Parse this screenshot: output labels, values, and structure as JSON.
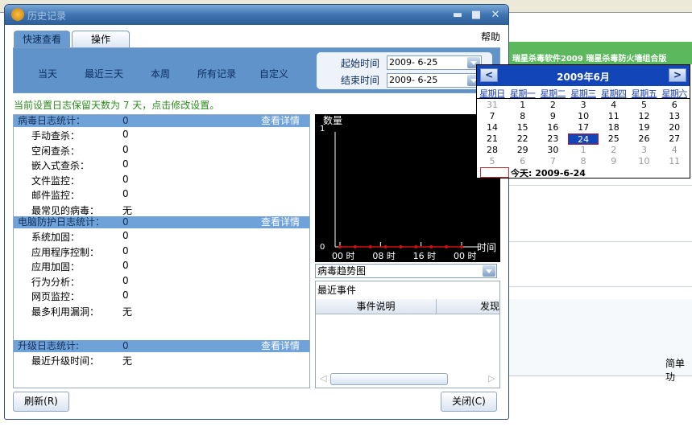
{
  "background": {
    "banner": "瑞星杀毒软件2009  瑞星杀毒防火墙组合版",
    "bottom_text": "简单功"
  },
  "window": {
    "title": "历史记录",
    "minimize": "▬",
    "maximize": "■",
    "close": "✕"
  },
  "tabs": [
    {
      "label": "快速查看"
    },
    {
      "label": "操作"
    }
  ],
  "help": "帮助",
  "quick_links": [
    "当天",
    "最近三天",
    "本周",
    "所有记录",
    "自定义"
  ],
  "dates": {
    "start_label": "起始时间",
    "start_value": "2009- 6-25",
    "end_label": "结束时间",
    "end_value": "2009- 6-25"
  },
  "notice": "当前设置日志保留天数为 7 天，点击修改设置。",
  "sections": [
    {
      "title": "病毒日志统计：",
      "value": "0",
      "detail": "查看详情",
      "rows": [
        {
          "label": "手动查杀：",
          "value": "0"
        },
        {
          "label": "空闲查杀：",
          "value": "0"
        },
        {
          "label": "嵌入式查杀：",
          "value": "0"
        },
        {
          "label": "文件监控：",
          "value": "0"
        },
        {
          "label": "邮件监控：",
          "value": "0"
        },
        {
          "label": "最常见的病毒：",
          "value": "无"
        }
      ]
    },
    {
      "title": "电脑防护日志统计：",
      "value": "0",
      "detail": "查看详情",
      "rows": [
        {
          "label": "系统加固：",
          "value": "0"
        },
        {
          "label": "应用程序控制：",
          "value": "0"
        },
        {
          "label": "应用加固：",
          "value": "0"
        },
        {
          "label": "行为分析：",
          "value": "0"
        },
        {
          "label": "网页监控：",
          "value": "0"
        },
        {
          "label": "最多利用漏洞：",
          "value": "无"
        }
      ]
    },
    {
      "title": "升级日志统计:",
      "value": "0",
      "detail": "查看详情",
      "rows": [
        {
          "label": "最近升级时间：",
          "value": "无"
        }
      ]
    }
  ],
  "chart": {
    "ylabel": "数量",
    "ymax": "1",
    "ymin": "0",
    "xlabel": "时间",
    "xticks": [
      "00 时",
      "08 时",
      "16 时",
      "00 时"
    ],
    "values": [
      0,
      0,
      0,
      0,
      0,
      0,
      0,
      0,
      0
    ],
    "line_color": "#d01010"
  },
  "trend_select": "病毒趋势图",
  "events": {
    "title": "最近事件",
    "columns": [
      "事件说明",
      "发现"
    ]
  },
  "buttons": {
    "refresh": "刷新(R)",
    "close": "关闭(C)"
  },
  "calendar": {
    "title": "2009年6月",
    "prev": "<",
    "next": ">",
    "dow": [
      "星期日",
      "星期一",
      "星期二",
      "星期三",
      "星期四",
      "星期五",
      "星期六"
    ],
    "weeks": [
      [
        "31",
        "1",
        "2",
        "3",
        "4",
        "5",
        "6"
      ],
      [
        "7",
        "8",
        "9",
        "10",
        "11",
        "12",
        "13"
      ],
      [
        "14",
        "15",
        "16",
        "17",
        "18",
        "19",
        "20"
      ],
      [
        "21",
        "22",
        "23",
        "24",
        "25",
        "26",
        "27"
      ],
      [
        "28",
        "29",
        "30",
        "1",
        "2",
        "3",
        "4"
      ],
      [
        "5",
        "6",
        "7",
        "8",
        "9",
        "10",
        "11"
      ]
    ],
    "selected": "24",
    "today": "今天: 2009-6-24"
  }
}
